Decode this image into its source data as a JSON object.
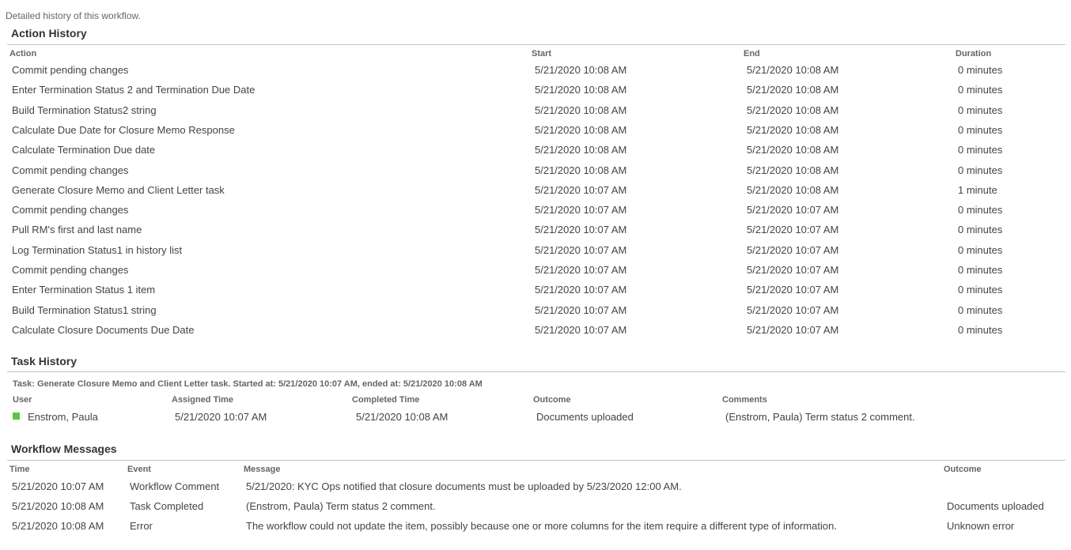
{
  "description": "Detailed history of this workflow.",
  "action_history": {
    "title": "Action History",
    "columns": [
      "Action",
      "Start",
      "End",
      "Duration"
    ],
    "rows": [
      [
        "Commit pending changes",
        "5/21/2020 10:08 AM",
        "5/21/2020 10:08 AM",
        "0 minutes"
      ],
      [
        "Enter Termination Status 2 and Termination Due Date",
        "5/21/2020 10:08 AM",
        "5/21/2020 10:08 AM",
        "0 minutes"
      ],
      [
        "Build Termination Status2 string",
        "5/21/2020 10:08 AM",
        "5/21/2020 10:08 AM",
        "0 minutes"
      ],
      [
        "Calculate Due Date for Closure Memo Response",
        "5/21/2020 10:08 AM",
        "5/21/2020 10:08 AM",
        "0 minutes"
      ],
      [
        "Calculate Termination Due date",
        "5/21/2020 10:08 AM",
        "5/21/2020 10:08 AM",
        "0 minutes"
      ],
      [
        "Commit pending changes",
        "5/21/2020 10:08 AM",
        "5/21/2020 10:08 AM",
        "0 minutes"
      ],
      [
        "Generate Closure Memo and Client Letter task",
        "5/21/2020 10:07 AM",
        "5/21/2020 10:08 AM",
        "1 minute"
      ],
      [
        "Commit pending changes",
        "5/21/2020 10:07 AM",
        "5/21/2020 10:07 AM",
        "0 minutes"
      ],
      [
        "Pull RM's first and last name",
        "5/21/2020 10:07 AM",
        "5/21/2020 10:07 AM",
        "0 minutes"
      ],
      [
        "Log Termination Status1 in history list",
        "5/21/2020 10:07 AM",
        "5/21/2020 10:07 AM",
        "0 minutes"
      ],
      [
        "Commit pending changes",
        "5/21/2020 10:07 AM",
        "5/21/2020 10:07 AM",
        "0 minutes"
      ],
      [
        "Enter Termination Status 1 item",
        "5/21/2020 10:07 AM",
        "5/21/2020 10:07 AM",
        "0 minutes"
      ],
      [
        "Build Termination Status1 string",
        "5/21/2020 10:07 AM",
        "5/21/2020 10:07 AM",
        "0 minutes"
      ],
      [
        "Calculate Closure Documents Due Date",
        "5/21/2020 10:07 AM",
        "5/21/2020 10:07 AM",
        "0 minutes"
      ]
    ]
  },
  "task_history": {
    "title": "Task History",
    "task_line": "Task: Generate Closure Memo and Client Letter task. Started at: 5/21/2020 10:07 AM, ended at: 5/21/2020 10:08 AM",
    "columns": [
      "User",
      "Assigned Time",
      "Completed Time",
      "Outcome",
      "Comments"
    ],
    "rows": [
      {
        "user": "Enstrom, Paula",
        "presence_color": "#5dc542",
        "assigned": "5/21/2020 10:07 AM",
        "completed": "5/21/2020 10:08 AM",
        "outcome": "Documents uploaded",
        "comments": "(Enstrom, Paula) Term status 2 comment."
      }
    ]
  },
  "workflow_messages": {
    "title": "Workflow Messages",
    "columns": [
      "Time",
      "Event",
      "Message",
      "Outcome"
    ],
    "rows": [
      [
        "5/21/2020 10:07 AM",
        "Workflow Comment",
        "5/21/2020: KYC Ops notified that closure documents must be uploaded by 5/23/2020 12:00 AM.",
        ""
      ],
      [
        "5/21/2020 10:08 AM",
        "Task Completed",
        "(Enstrom, Paula) Term status 2 comment.",
        "Documents uploaded"
      ],
      [
        "5/21/2020 10:08 AM",
        "Error",
        "The workflow could not update the item, possibly because one or more columns for the item require a different type of information.",
        "Unknown error"
      ]
    ]
  }
}
